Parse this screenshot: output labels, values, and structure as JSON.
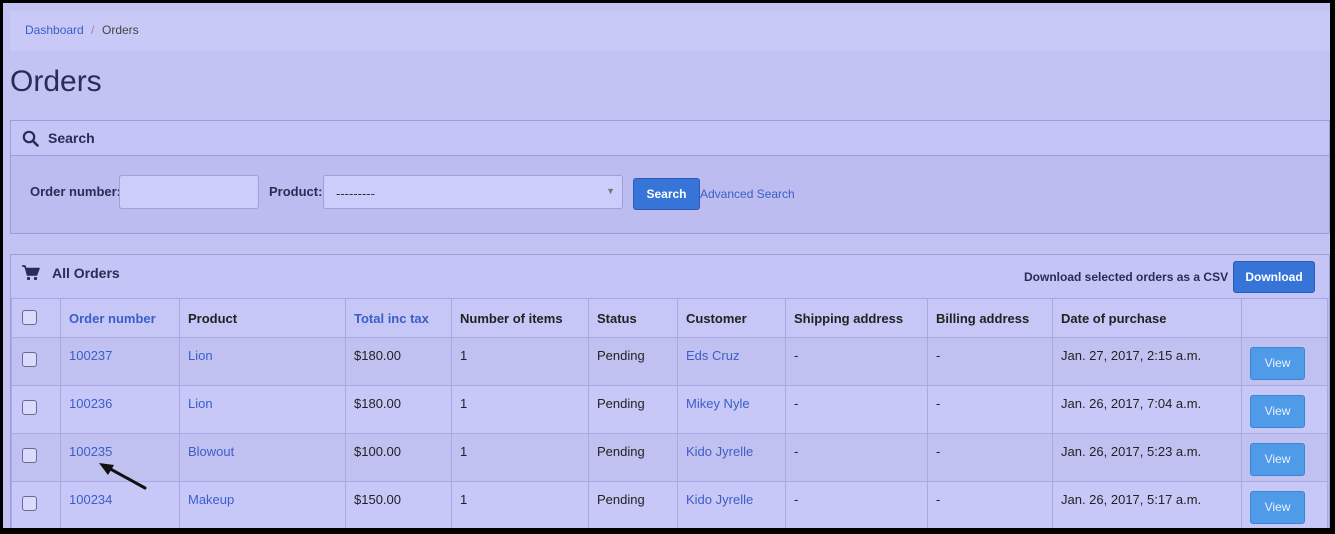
{
  "breadcrumb": {
    "home": "Dashboard",
    "separator": "/",
    "current": "Orders"
  },
  "page_title": "Orders",
  "search_panel": {
    "title": "Search",
    "order_number_label": "Order number:",
    "order_number_value": "",
    "product_label": "Product:",
    "product_selected": "---------",
    "search_button": "Search",
    "advanced_link": "Advanced Search"
  },
  "orders_panel": {
    "title": "All Orders",
    "csv_label": "Download selected orders as a CSV",
    "download_button": "Download"
  },
  "table": {
    "headers": [
      "Order number",
      "Product",
      "Total inc tax",
      "Number of items",
      "Status",
      "Customer",
      "Shipping address",
      "Billing address",
      "Date of purchase"
    ],
    "rows": [
      {
        "order": "100237",
        "product": "Lion",
        "total": "$180.00",
        "items": "1",
        "status": "Pending",
        "customer": "Eds Cruz",
        "shipping": "-",
        "billing": "-",
        "date": "Jan. 27, 2017, 2:15 a.m.",
        "action": "View"
      },
      {
        "order": "100236",
        "product": "Lion",
        "total": "$180.00",
        "items": "1",
        "status": "Pending",
        "customer": "Mikey Nyle",
        "shipping": "-",
        "billing": "-",
        "date": "Jan. 26, 2017, 7:04 a.m.",
        "action": "View"
      },
      {
        "order": "100235",
        "product": "Blowout",
        "total": "$100.00",
        "items": "1",
        "status": "Pending",
        "customer": "Kido Jyrelle",
        "shipping": "-",
        "billing": "-",
        "date": "Jan. 26, 2017, 5:23 a.m.",
        "action": "View"
      },
      {
        "order": "100234",
        "product": "Makeup",
        "total": "$150.00",
        "items": "1",
        "status": "Pending",
        "customer": "Kido Jyrelle",
        "shipping": "-",
        "billing": "-",
        "date": "Jan. 26, 2017, 5:17 a.m.",
        "action": "View"
      }
    ]
  },
  "icons": {
    "search": "search-icon",
    "cart": "shopping-cart-icon",
    "select_caret": "caret-down-icon",
    "annotation": "arrow-icon"
  },
  "colors": {
    "accent": "#3674d8",
    "link": "#3a5fc6",
    "view_button": "#4f9be8",
    "background": "#c3c3f3"
  }
}
